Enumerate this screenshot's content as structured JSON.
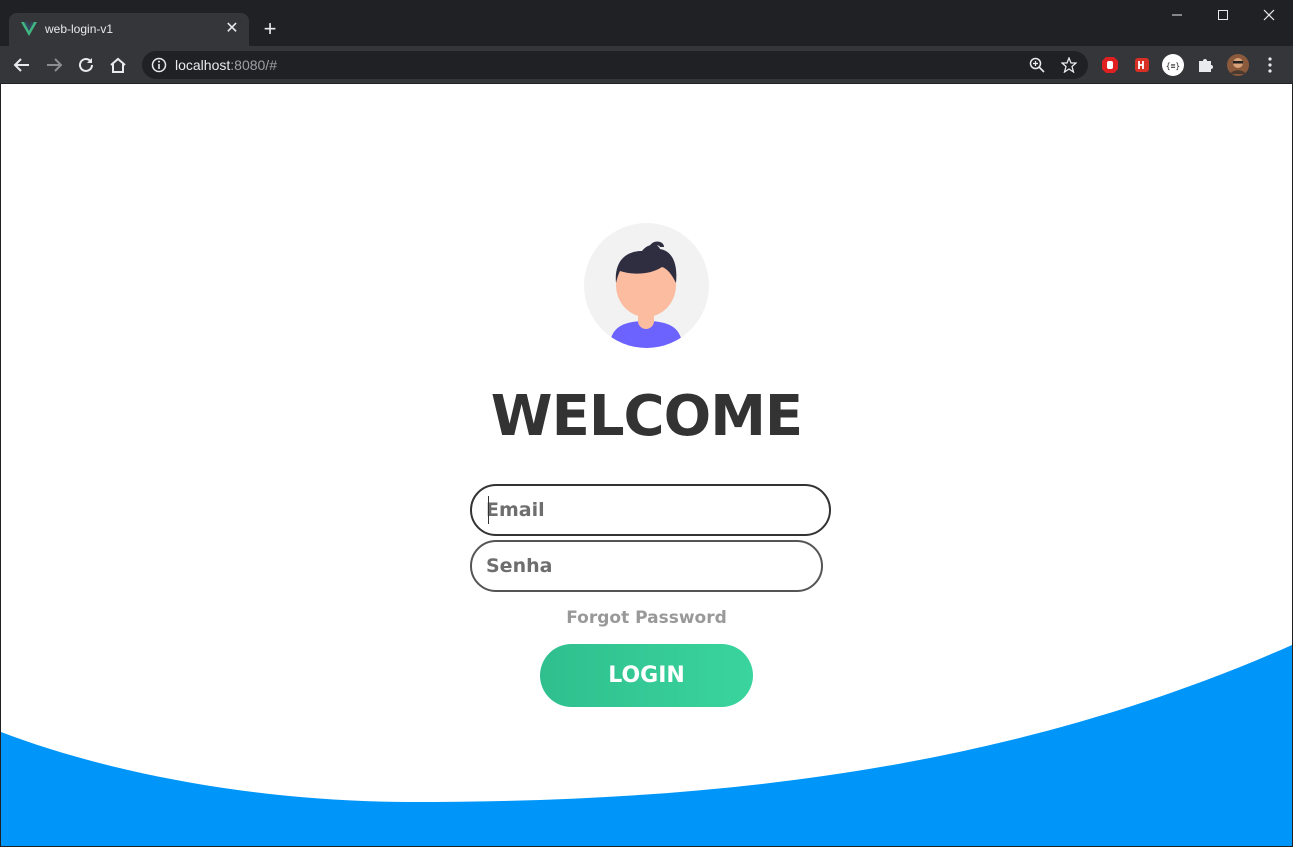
{
  "browser": {
    "tab_title": "web-login-v1",
    "url_host": "localhost",
    "url_rest": ":8080/#",
    "favicon_color": "#41b883"
  },
  "page": {
    "welcome": "WELCOME",
    "email_placeholder": "Email",
    "password_placeholder": "Senha",
    "forgot_password": "Forgot Password",
    "login_label": "LOGIN",
    "wave_color": "#0096f9",
    "button_gradient": [
      "#2fbf8e",
      "#3ad49e"
    ]
  }
}
